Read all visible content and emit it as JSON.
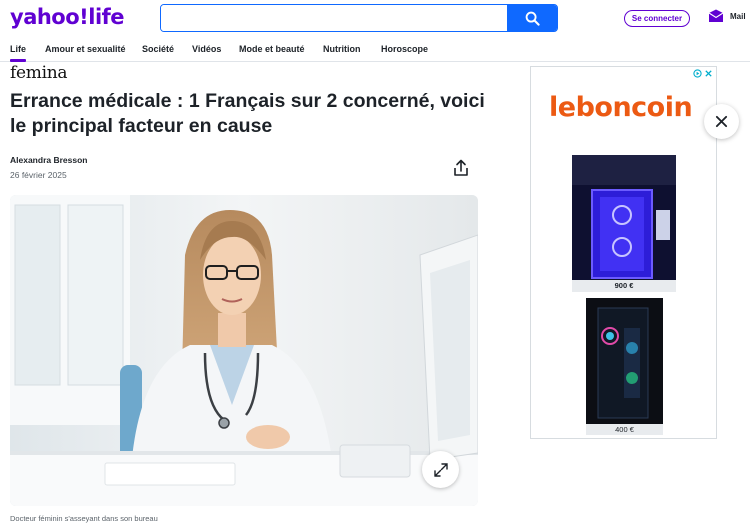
{
  "header": {
    "logo": "yahoo!life",
    "search": {
      "value": "",
      "placeholder": ""
    },
    "signin_label": "Se connecter",
    "mail_label": "Mail"
  },
  "nav": {
    "items": [
      {
        "label": "Life",
        "active": true
      },
      {
        "label": "Amour et sexualité"
      },
      {
        "label": "Société"
      },
      {
        "label": "Vidéos"
      },
      {
        "label": "Mode et beauté"
      },
      {
        "label": "Nutrition"
      },
      {
        "label": "Horoscope"
      }
    ]
  },
  "article": {
    "source": "femina",
    "title": "Errance médicale : 1 Français sur 2 concerné, voici le principal facteur en cause",
    "author": "Alexandra Bresson",
    "date": "26 février 2025",
    "caption": "Docteur féminin s'asseyant dans son bureau"
  },
  "ad": {
    "brand": "leboncoin",
    "products": [
      {
        "price": "900 €"
      },
      {
        "price": "400 €"
      }
    ]
  },
  "colors": {
    "brand_purple": "#6001d2",
    "search_blue": "#0f69ff",
    "leboncoin_orange": "#ec5a13",
    "ad_choices_blue": "#00aecd"
  },
  "icons": [
    "search-icon",
    "mail-icon",
    "share-icon",
    "expand-icon",
    "close-icon",
    "adchoices-icon"
  ]
}
